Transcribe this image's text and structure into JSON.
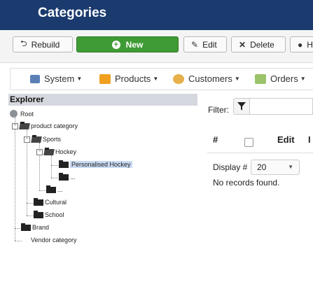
{
  "header": {
    "title": "Categories"
  },
  "toolbar": {
    "rebuild_label": "Rebuild",
    "new_label": "New",
    "edit_label": "Edit",
    "delete_label": "Delete",
    "help_label": "H",
    "accent_green": "#3f9b35"
  },
  "menu": {
    "items": [
      {
        "label": "System",
        "icon": "wrench-icon"
      },
      {
        "label": "Products",
        "icon": "box-icon"
      },
      {
        "label": "Customers",
        "icon": "users-icon"
      },
      {
        "label": "Orders",
        "icon": "clipboard-icon"
      }
    ]
  },
  "explorer": {
    "title": "Explorer",
    "root": "Root",
    "nodes": {
      "product_category": "product category",
      "sports": "Sports",
      "hockey": "Hockey",
      "personalised_hockey": "Personalised Hockey",
      "hockey_more": "...",
      "sports_more": "...",
      "cultural": "Cultural",
      "school": "School",
      "brand": "Brand",
      "vendor_category": "Vendor category"
    }
  },
  "filter": {
    "label": "Filter:",
    "value": ""
  },
  "table": {
    "columns": [
      "#",
      "",
      "Edit",
      "I"
    ]
  },
  "pagination": {
    "display_label": "Display #",
    "display_value": "20",
    "empty_message": "No records found."
  }
}
